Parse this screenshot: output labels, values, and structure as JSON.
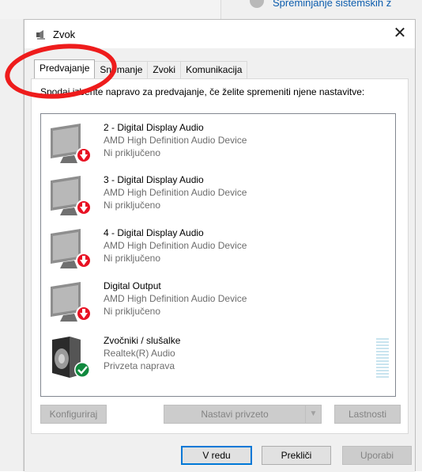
{
  "background": {
    "link_text": "Spreminjanje sistemskih z"
  },
  "window": {
    "title": "Zvok",
    "close_glyph": "✕"
  },
  "tabs": [
    {
      "label": "Predvajanje",
      "active": true
    },
    {
      "label": "Snemanje",
      "active": false
    },
    {
      "label": "Zvoki",
      "active": false
    },
    {
      "label": "Komunikacija",
      "active": false
    }
  ],
  "instructions": "Spodaj izberite napravo za predvajanje, če želite spremeniti njene nastavitve:",
  "devices": [
    {
      "name": "2 - Digital Display Audio",
      "description": "AMD High Definition Audio Device",
      "status": "Ni priključeno",
      "icon": "monitor-icon",
      "status_icon": "disconnected-down-arrow-icon"
    },
    {
      "name": "3 - Digital Display Audio",
      "description": "AMD High Definition Audio Device",
      "status": "Ni priključeno",
      "icon": "monitor-icon",
      "status_icon": "disconnected-down-arrow-icon"
    },
    {
      "name": "4 - Digital Display Audio",
      "description": "AMD High Definition Audio Device",
      "status": "Ni priključeno",
      "icon": "monitor-icon",
      "status_icon": "disconnected-down-arrow-icon"
    },
    {
      "name": "Digital Output",
      "description": "AMD High Definition Audio Device",
      "status": "Ni priključeno",
      "icon": "monitor-icon",
      "status_icon": "disconnected-down-arrow-icon"
    },
    {
      "name": "Zvočniki / slušalke",
      "description": "Realtek(R) Audio",
      "status": "Privzeta naprava",
      "icon": "speaker-icon",
      "status_icon": "default-checkmark-icon"
    }
  ],
  "buttons": {
    "configure": "Konfiguriraj",
    "set_default": "Nastavi privzeto",
    "properties": "Lastnosti",
    "ok": "V redu",
    "cancel": "Prekliči",
    "apply": "Uporabi"
  },
  "colors": {
    "accent": "#0078d7",
    "annotation": "#ee1c1c",
    "disconnected": "#e81123",
    "default_ok": "#10893e"
  }
}
